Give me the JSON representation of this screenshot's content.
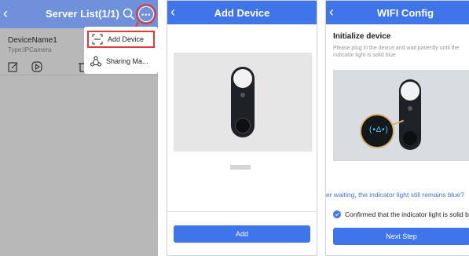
{
  "colors": {
    "accent": "#3f74ea",
    "highlight": "#e03a3a"
  },
  "server_list": {
    "title": "Server List(1/1)",
    "device": {
      "name": "DeviceName1",
      "type": "Type:IPCamera"
    },
    "menu": [
      {
        "label": "Add Device",
        "icon": "scan-icon"
      },
      {
        "label": "Sharing Ma...",
        "icon": "share-icon"
      }
    ]
  },
  "add_device": {
    "title": "Add Device",
    "button_label": "Add"
  },
  "wifi_config": {
    "title": "WIFI Config",
    "heading": "Initialize device",
    "description": "Please plug in the device and wait patiently until the indicator light is solid blue",
    "waiting_link": "er waiting, the indicator light still remains blue?",
    "confirm_label": "Confirmed that the indicator light is solid b",
    "next_label": "Next Step"
  }
}
